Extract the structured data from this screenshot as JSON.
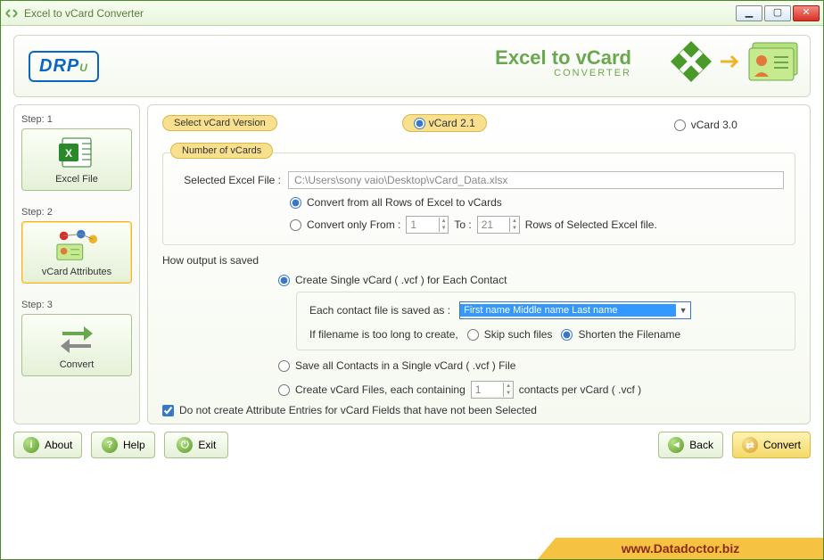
{
  "window": {
    "title": "Excel to vCard Converter"
  },
  "header": {
    "logo": "DRPU",
    "title_line1": "Excel to vCard",
    "title_line2": "CONVERTER"
  },
  "sidebar": {
    "steps": [
      {
        "label": "Step: 1",
        "button": "Excel File"
      },
      {
        "label": "Step: 2",
        "button": "vCard Attributes"
      },
      {
        "label": "Step: 3",
        "button": "Convert"
      }
    ]
  },
  "main": {
    "section_version": "Select vCard Version",
    "version_options": {
      "v21": "vCard 2.1",
      "v30": "vCard 3.0"
    },
    "section_number": "Number of vCards",
    "selected_file_label": "Selected Excel File :",
    "selected_file_value": "C:\\Users\\sony vaio\\Desktop\\vCard_Data.xlsx",
    "convert_all": "Convert from all Rows of Excel to vCards",
    "convert_only": "Convert only   From :",
    "from_value": "1",
    "to_label": "To :",
    "to_value": "21",
    "rows_suffix": "Rows of Selected Excel file.",
    "output_heading": "How output is saved",
    "create_single": "Create Single vCard ( .vcf ) for Each Contact",
    "each_contact_label": "Each contact file is saved as :",
    "each_contact_value": "First name Middle name Last name",
    "too_long_label": "If filename is too long to create,",
    "skip_files": "Skip such files",
    "shorten": "Shorten the Filename",
    "save_all": "Save all Contacts in a Single vCard ( .vcf ) File",
    "create_each": "Create vCard Files, each containing",
    "per_vcard_value": "1",
    "per_vcard_suffix": "contacts per vCard ( .vcf )",
    "dont_create_attr": "Do not create Attribute Entries for vCard Fields that have not been Selected"
  },
  "footer": {
    "about": "About",
    "help": "Help",
    "exit": "Exit",
    "back": "Back",
    "convert": "Convert"
  },
  "website": "www.Datadoctor.biz"
}
